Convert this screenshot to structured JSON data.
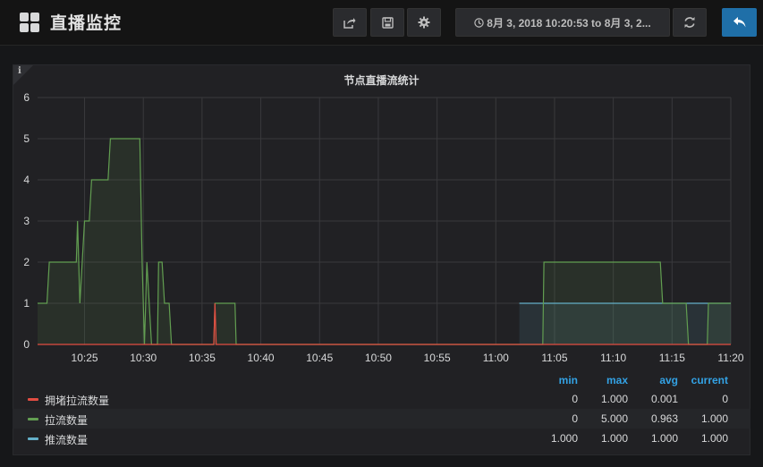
{
  "header": {
    "title": "直播监控",
    "time_range": "8月 3, 2018 10:20:53 to 8月 3, 2..."
  },
  "panel": {
    "title": "节点直播流统计",
    "info_label": "i"
  },
  "legend": {
    "headers": [
      "min",
      "max",
      "avg",
      "current"
    ],
    "rows": [
      {
        "name": "拥堵拉流数量",
        "color": "#e24d42",
        "min": "0",
        "max": "1.000",
        "avg": "0.001",
        "current": "0"
      },
      {
        "name": "拉流数量",
        "color": "#629e51",
        "min": "0",
        "max": "5.000",
        "avg": "0.963",
        "current": "1.000"
      },
      {
        "name": "推流数量",
        "color": "#64b0c8",
        "min": "1.000",
        "max": "1.000",
        "avg": "1.000",
        "current": "1.000"
      }
    ]
  },
  "chart_data": {
    "type": "line",
    "title": "节点直播流统计",
    "xlim": [
      "10:21",
      "11:20"
    ],
    "ylim": [
      0,
      6
    ],
    "x_ticks": [
      "10:25",
      "10:30",
      "10:35",
      "10:40",
      "10:45",
      "10:50",
      "10:55",
      "11:00",
      "11:05",
      "11:10",
      "11:15",
      "11:20"
    ],
    "y_ticks": [
      "0",
      "1",
      "2",
      "3",
      "4",
      "5",
      "6"
    ],
    "grid": true,
    "series": [
      {
        "name": "拥堵拉流数量",
        "color": "#e24d42",
        "points": [
          [
            "10:21",
            0
          ],
          [
            "10:36.0",
            0
          ],
          [
            "10:36.1",
            1
          ],
          [
            "10:36.2",
            0
          ],
          [
            "11:20",
            0
          ]
        ]
      },
      {
        "name": "拉流数量",
        "color": "#629e51",
        "points": [
          [
            "10:21",
            1
          ],
          [
            "10:21.8",
            1
          ],
          [
            "10:22",
            2
          ],
          [
            "10:24.3",
            2
          ],
          [
            "10:24.4",
            3
          ],
          [
            "10:24.6",
            1
          ],
          [
            "10:25",
            3
          ],
          [
            "10:25.4",
            3
          ],
          [
            "10:25.6",
            4
          ],
          [
            "10:27",
            4
          ],
          [
            "10:27.2",
            5
          ],
          [
            "10:29.7",
            5
          ],
          [
            "10:29.9",
            2
          ],
          [
            "10:30.1",
            0
          ],
          [
            "10:30.3",
            2
          ],
          [
            "10:30.5",
            1
          ],
          [
            "10:30.7",
            0
          ],
          [
            "10:31.2",
            0
          ],
          [
            "10:31.3",
            2
          ],
          [
            "10:31.6",
            2
          ],
          [
            "10:31.8",
            1
          ],
          [
            "10:32.2",
            1
          ],
          [
            "10:32.4",
            0
          ],
          [
            "10:36",
            0
          ],
          [
            "10:36.1",
            1
          ],
          [
            "10:37.8",
            1
          ],
          [
            "10:37.9",
            0
          ],
          [
            "11:04",
            0
          ],
          [
            "11:04.1",
            2
          ],
          [
            "11:14",
            2
          ],
          [
            "11:14.2",
            1
          ],
          [
            "11:16.2",
            1
          ],
          [
            "11:16.4",
            0
          ],
          [
            "11:18",
            0
          ],
          [
            "11:18.1",
            1
          ],
          [
            "11:20",
            1
          ]
        ]
      },
      {
        "name": "推流数量",
        "color": "#64b0c8",
        "points": [
          [
            "11:02",
            1
          ],
          [
            "11:20",
            1
          ]
        ]
      }
    ],
    "legend": {
      "position": "bottom",
      "values": [
        "min",
        "max",
        "avg",
        "current"
      ]
    }
  }
}
